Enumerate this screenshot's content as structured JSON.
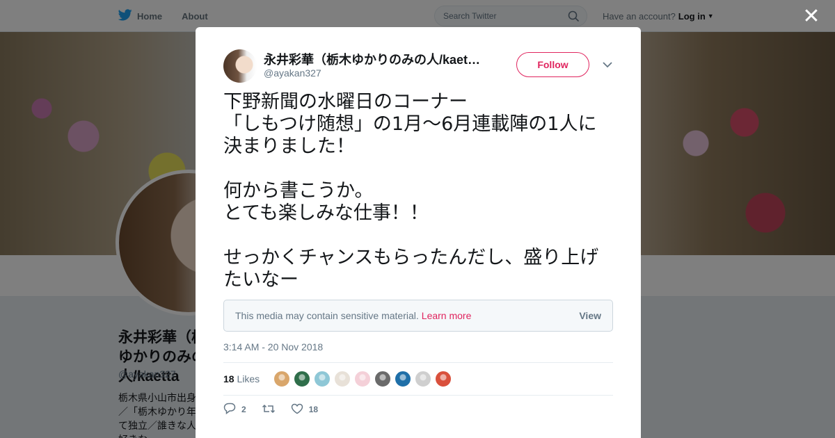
{
  "nav": {
    "home_label": "Home",
    "about_label": "About",
    "search_placeholder": "Search Twitter",
    "have_account": "Have an account?",
    "login_label": "Log in"
  },
  "profile": {
    "name": "永井彩華（栃木ゆかりのみの人/kaetta",
    "handle": "@ayakan327",
    "bio": "栃木県小山市出身／表／「栃木ゆかり年続けて独立／誰きな人と、好きな"
  },
  "tweet": {
    "author_name": "永井彩華（栃木ゆかりのみの人/kaet…",
    "author_handle": "@ayakan327",
    "follow_label": "Follow",
    "text": "下野新聞の水曜日のコーナー\n「しもつけ随想」の1月〜6月連載陣の1人に決まりました！\n\n何から書こうか。\nとても楽しみな仕事！！\n\nせっかくチャンスもらったんだし、盛り上げたいなー",
    "sensitive_notice": "This media may contain sensitive material.",
    "learn_more": "Learn more",
    "view_label": "View",
    "timestamp": "3:14 AM - 20 Nov 2018",
    "likes_count": "18",
    "likes_label": "Likes",
    "reply_count": "2",
    "like_count": "18"
  },
  "likers": [
    {
      "icon": "liker-avatar-1",
      "color": "#d9a66b"
    },
    {
      "icon": "liker-avatar-2",
      "color": "#2f6e4a"
    },
    {
      "icon": "liker-avatar-3",
      "color": "#8ec7d6"
    },
    {
      "icon": "liker-avatar-4",
      "color": "#e8e1d8"
    },
    {
      "icon": "liker-avatar-5",
      "color": "#f4d0d8"
    },
    {
      "icon": "liker-avatar-6",
      "color": "#6a6a6a"
    },
    {
      "icon": "liker-avatar-7",
      "color": "#1f6fa8"
    },
    {
      "icon": "liker-avatar-8",
      "color": "#cfcfcf"
    },
    {
      "icon": "liker-avatar-9",
      "color": "#d9503c"
    }
  ],
  "colors": {
    "accent": "#e0245e",
    "twitter_blue": "#1da1f2",
    "text": "#14171a",
    "muted": "#657786"
  }
}
